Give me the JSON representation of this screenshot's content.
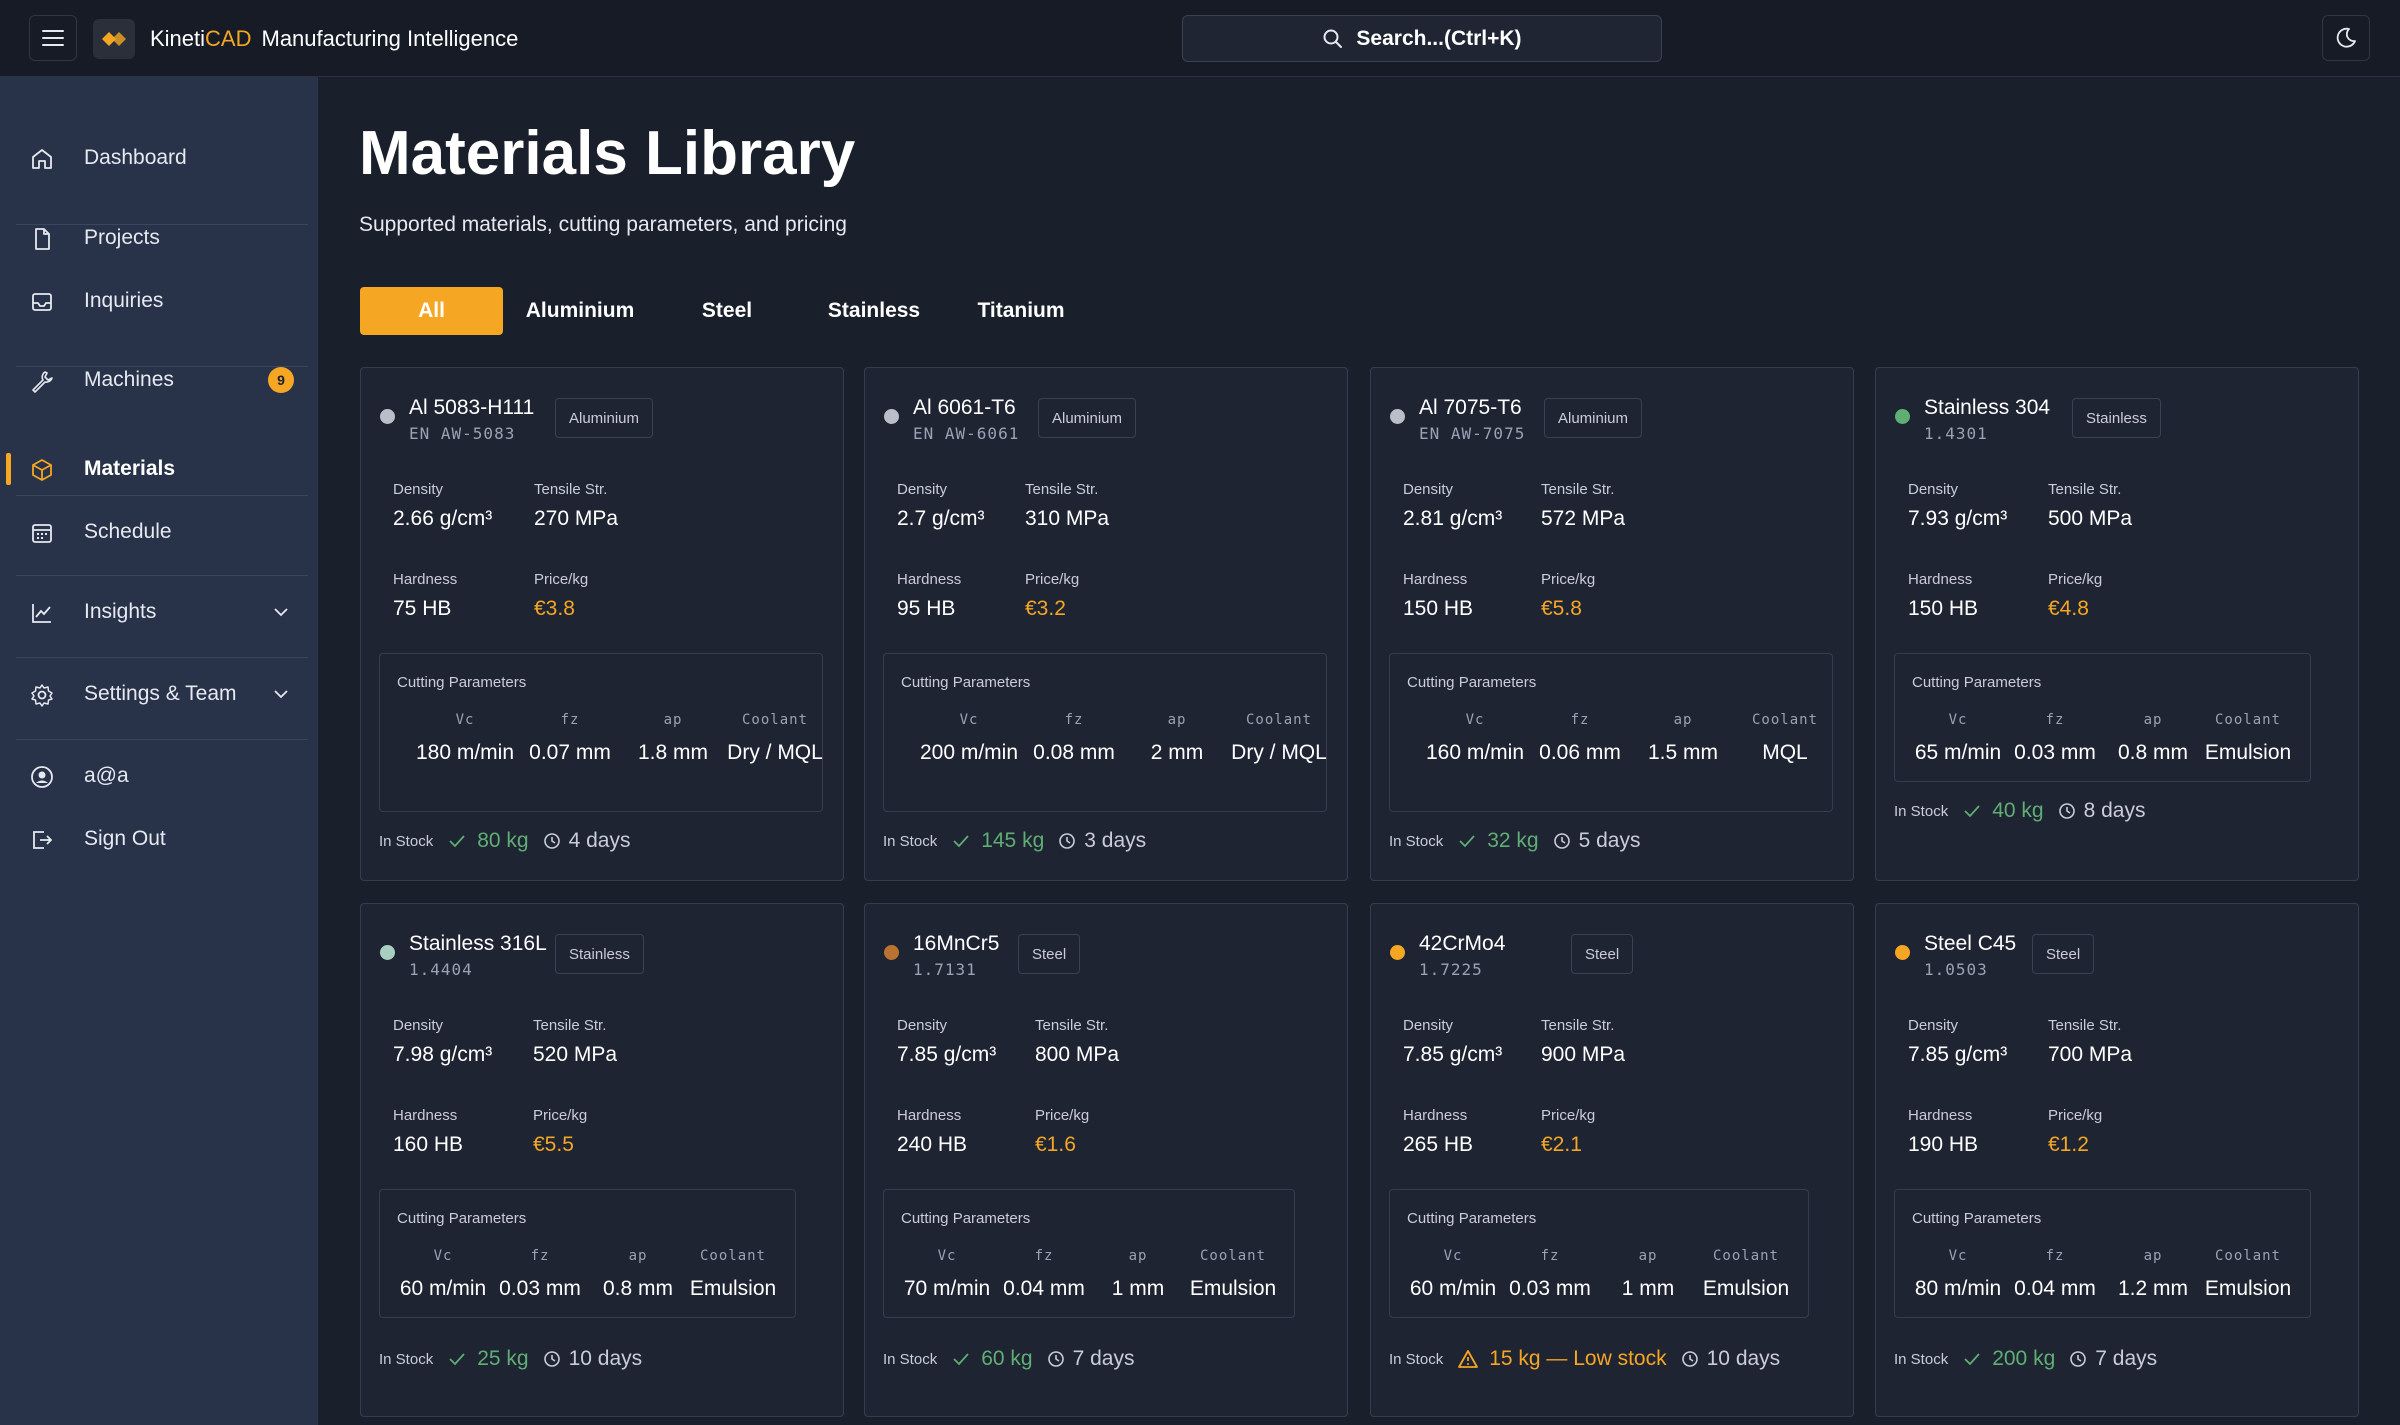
{
  "app": {
    "brand_prefix": "Kineti",
    "brand_accent": "CAD",
    "subtitle": "Manufacturing Intelligence",
    "search_placeholder": "Search...(Ctrl+K)"
  },
  "sidebar": {
    "items": [
      {
        "label": "Dashboard",
        "icon": "home-icon"
      },
      {
        "label": "Projects",
        "icon": "file-icon"
      },
      {
        "label": "Inquiries",
        "icon": "inbox-icon"
      },
      {
        "label": "Machines",
        "icon": "wrench-icon",
        "badge": "9"
      },
      {
        "label": "Materials",
        "icon": "box-icon",
        "active": true
      },
      {
        "label": "Schedule",
        "icon": "calendar-icon"
      },
      {
        "label": "Insights",
        "icon": "chart-line-icon"
      },
      {
        "label": "Settings & Team",
        "icon": "gear-icon"
      },
      {
        "label": "a@a",
        "icon": "user-circle-icon"
      },
      {
        "label": "Sign Out",
        "icon": "sign-out-icon"
      }
    ]
  },
  "main": {
    "title": "Materials Library",
    "subtitle": "Supported materials, cutting parameters, and pricing",
    "tabs": [
      "All",
      "Aluminium",
      "Steel",
      "Stainless",
      "Titanium"
    ]
  },
  "labels": {
    "density": "Density",
    "tensile": "Tensile Str.",
    "hardness": "Hardness",
    "price": "Price/kg",
    "cutting": "Cutting Parameters",
    "vc": "Vc",
    "fz": "fz",
    "ap": "ap",
    "coolant": "Coolant",
    "in_stock": "In Stock"
  },
  "colors": {
    "accent": "#f5a623",
    "stock_ok": "#5fae74",
    "dot_aluminium": "#b9bec9",
    "dot_stainless_304": "#5fae74",
    "dot_stainless_316": "#a9cfc0",
    "dot_16mncr5": "#b87333",
    "dot_42crmo4": "#f5a623",
    "dot_c45": "#f5a623"
  },
  "materials": [
    {
      "name": "Al 5083-H111",
      "code": "EN AW-5083",
      "category": "Aluminium",
      "density": "2.66 g/cm³",
      "tensile": "270 MPa",
      "hardness": "75 HB",
      "price": "€3.8",
      "vc": "180 m/min",
      "fz": "0.07 mm",
      "ap": "1.8 mm",
      "coolant": "Dry / MQL",
      "stock": "80 kg",
      "lead": "4 days"
    },
    {
      "name": "Al 6061-T6",
      "code": "EN AW-6061",
      "category": "Aluminium",
      "density": "2.7 g/cm³",
      "tensile": "310 MPa",
      "hardness": "95 HB",
      "price": "€3.2",
      "vc": "200 m/min",
      "fz": "0.08 mm",
      "ap": "2 mm",
      "coolant": "Dry / MQL",
      "stock": "145 kg",
      "lead": "3 days"
    },
    {
      "name": "Al 7075-T6",
      "code": "EN AW-7075",
      "category": "Aluminium",
      "density": "2.81 g/cm³",
      "tensile": "572 MPa",
      "hardness": "150 HB",
      "price": "€5.8",
      "vc": "160 m/min",
      "fz": "0.06 mm",
      "ap": "1.5 mm",
      "coolant": "MQL",
      "stock": "32 kg",
      "lead": "5 days"
    },
    {
      "name": "Stainless 304",
      "code": "1.4301",
      "category": "Stainless",
      "density": "7.93 g/cm³",
      "tensile": "500 MPa",
      "hardness": "150 HB",
      "price": "€4.8",
      "vc": "65 m/min",
      "fz": "0.03 mm",
      "ap": "0.8 mm",
      "coolant": "Emulsion",
      "stock": "40 kg",
      "lead": "8 days"
    },
    {
      "name": "Stainless 316L",
      "code": "1.4404",
      "category": "Stainless",
      "density": "7.98 g/cm³",
      "tensile": "520 MPa",
      "hardness": "160 HB",
      "price": "€5.5",
      "vc": "60 m/min",
      "fz": "0.03 mm",
      "ap": "0.8 mm",
      "coolant": "Emulsion",
      "stock": "25 kg",
      "lead": "10 days"
    },
    {
      "name": "16MnCr5",
      "code": "1.7131",
      "category": "Steel",
      "density": "7.85 g/cm³",
      "tensile": "800 MPa",
      "hardness": "240 HB",
      "price": "€1.6",
      "vc": "70 m/min",
      "fz": "0.04 mm",
      "ap": "1 mm",
      "coolant": "Emulsion",
      "stock": "60 kg",
      "lead": "7 days"
    },
    {
      "name": "42CrMo4",
      "code": "1.7225",
      "category": "Steel",
      "density": "7.85 g/cm³",
      "tensile": "900 MPa",
      "hardness": "265 HB",
      "price": "€2.1",
      "vc": "60 m/min",
      "fz": "0.03 mm",
      "ap": "1 mm",
      "coolant": "Emulsion",
      "stock": "15 kg — Low stock",
      "lead": "10 days"
    },
    {
      "name": "Steel C45",
      "code": "1.0503",
      "category": "Steel",
      "density": "7.85 g/cm³",
      "tensile": "700 MPa",
      "hardness": "190 HB",
      "price": "€1.2",
      "vc": "80 m/min",
      "fz": "0.04 mm",
      "ap": "1.2 mm",
      "coolant": "Emulsion",
      "stock": "200 kg",
      "lead": "7 days"
    }
  ]
}
